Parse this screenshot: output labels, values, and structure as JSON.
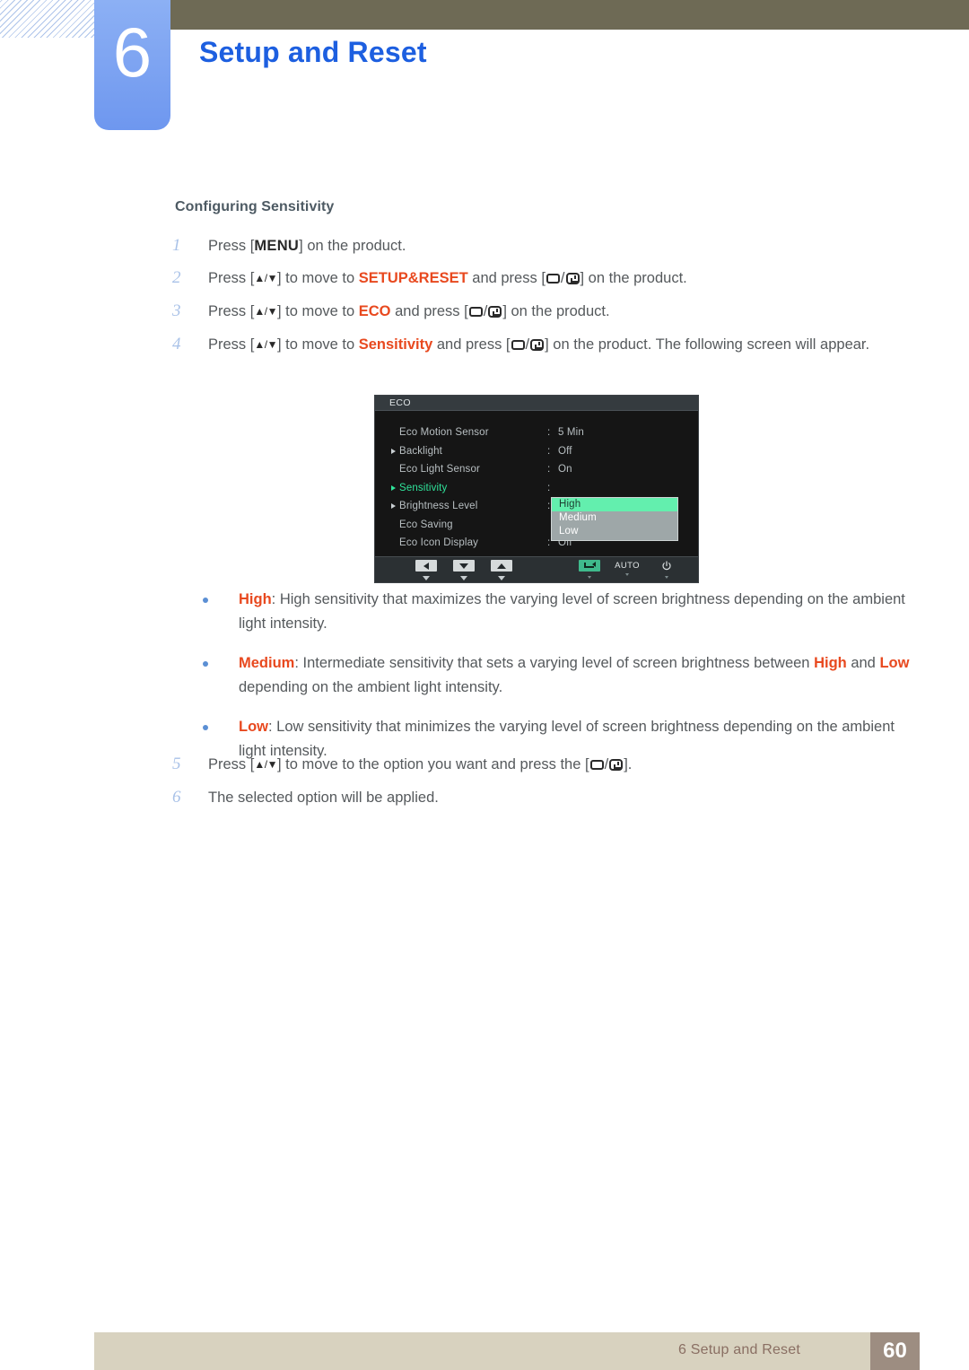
{
  "header": {
    "chapter_number": "6",
    "chapter_title": "Setup and Reset",
    "accent_blue": "#1d5fe0",
    "badge_blue": "#7fa5f2",
    "olive_bar": "#6e6a55"
  },
  "section": {
    "subhead": "Configuring Sensitivity"
  },
  "steps": [
    {
      "num": "1",
      "parts": [
        {
          "t": "Press [",
          "s": "plain"
        },
        {
          "t": "MENU",
          "s": "key"
        },
        {
          "t": "] on the product.",
          "s": "plain"
        }
      ]
    },
    {
      "num": "2",
      "parts": [
        {
          "t": "Press [",
          "s": "plain"
        },
        {
          "t": "▲/▼",
          "s": "arrows"
        },
        {
          "t": "] to move to ",
          "s": "plain"
        },
        {
          "t": "SETUP&RESET",
          "s": "hl"
        },
        {
          "t": " and press [",
          "s": "plain"
        },
        {
          "t": "",
          "s": "keyglyph"
        },
        {
          "t": "] on the product.",
          "s": "plain"
        }
      ]
    },
    {
      "num": "3",
      "parts": [
        {
          "t": "Press [",
          "s": "plain"
        },
        {
          "t": "▲/▼",
          "s": "arrows"
        },
        {
          "t": "] to move to ",
          "s": "plain"
        },
        {
          "t": "ECO",
          "s": "hl"
        },
        {
          "t": " and press [",
          "s": "plain"
        },
        {
          "t": "",
          "s": "keyglyph"
        },
        {
          "t": "] on the product.",
          "s": "plain"
        }
      ]
    },
    {
      "num": "4",
      "parts": [
        {
          "t": "Press [",
          "s": "plain"
        },
        {
          "t": "▲/▼",
          "s": "arrows"
        },
        {
          "t": "] to move to ",
          "s": "plain"
        },
        {
          "t": "Sensitivity",
          "s": "hl"
        },
        {
          "t": " and press [",
          "s": "plain"
        },
        {
          "t": "",
          "s": "keyglyph"
        },
        {
          "t": "] on the product. The following screen will appear.",
          "s": "plain"
        }
      ]
    }
  ],
  "osd": {
    "title": "ECO",
    "rows": [
      {
        "label": "Eco Motion Sensor",
        "arrow": false,
        "colon": ":",
        "value": "5 Min",
        "selected": false
      },
      {
        "label": "Backlight",
        "arrow": true,
        "colon": ":",
        "value": "Off",
        "selected": false
      },
      {
        "label": "Eco Light Sensor",
        "arrow": false,
        "colon": ":",
        "value": "On",
        "selected": false
      },
      {
        "label": "Sensitivity",
        "arrow": true,
        "colon": ":",
        "value": "",
        "selected": true
      },
      {
        "label": "Brightness Level",
        "arrow": true,
        "colon": ":",
        "value": "",
        "selected": false
      },
      {
        "label": "Eco Saving",
        "arrow": false,
        "colon": "",
        "value": "",
        "selected": false
      },
      {
        "label": "Eco Icon Display",
        "arrow": false,
        "colon": ":",
        "value": "Off",
        "selected": false
      }
    ],
    "dropdown": {
      "options": [
        "High",
        "Medium",
        "Low"
      ],
      "selected": "High",
      "highlight_color": "#63efae",
      "panel_color": "#9ea7a8"
    },
    "footer_buttons": [
      {
        "name": "left-button",
        "glyph": "left",
        "label": ""
      },
      {
        "name": "down-button",
        "glyph": "down",
        "label": ""
      },
      {
        "name": "up-button",
        "glyph": "up",
        "label": ""
      },
      {
        "name": "enter-button",
        "glyph": "enter",
        "label": ""
      },
      {
        "name": "auto-button",
        "glyph": "text",
        "label": "AUTO"
      },
      {
        "name": "power-button",
        "glyph": "power",
        "label": ""
      }
    ]
  },
  "bullets": [
    {
      "parts": [
        {
          "t": "High",
          "s": "hl"
        },
        {
          "t": ": High sensitivity that maximizes the varying level of screen brightness depending on the ambient light intensity.",
          "s": "plain"
        }
      ]
    },
    {
      "parts": [
        {
          "t": "Medium",
          "s": "hl"
        },
        {
          "t": ": Intermediate sensitivity that sets a varying level of screen brightness between ",
          "s": "plain"
        },
        {
          "t": "High",
          "s": "hl"
        },
        {
          "t": " and ",
          "s": "plain"
        },
        {
          "t": "Low",
          "s": "hl"
        },
        {
          "t": " depending on the ambient light intensity.",
          "s": "plain"
        }
      ]
    },
    {
      "parts": [
        {
          "t": "Low",
          "s": "hl"
        },
        {
          "t": ": Low sensitivity that minimizes the varying level of screen brightness depending on the ambient light intensity.",
          "s": "plain"
        }
      ]
    }
  ],
  "steps_tail": [
    {
      "num": "5",
      "parts": [
        {
          "t": "Press [",
          "s": "plain"
        },
        {
          "t": "▲/▼",
          "s": "arrows"
        },
        {
          "t": "] to move to the option you want and press the [",
          "s": "plain"
        },
        {
          "t": "",
          "s": "keyglyph"
        },
        {
          "t": "].",
          "s": "plain"
        }
      ]
    },
    {
      "num": "6",
      "parts": [
        {
          "t": "The selected option will be applied.",
          "s": "plain"
        }
      ]
    }
  ],
  "footer": {
    "text": "6 Setup and Reset",
    "page": "60",
    "bar_color": "#d8d2bf",
    "page_box_color": "#9d8d81"
  }
}
